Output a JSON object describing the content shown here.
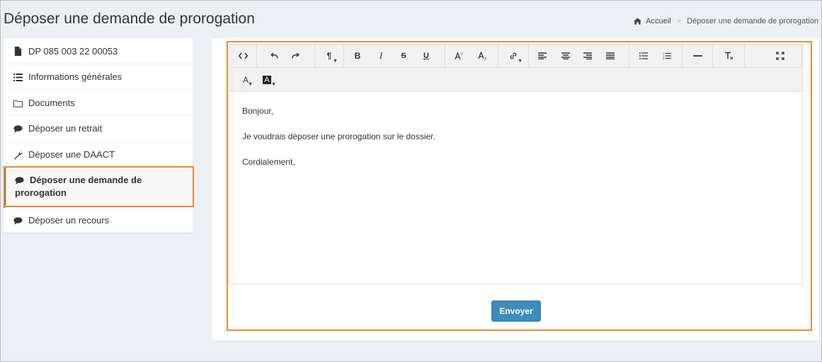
{
  "page": {
    "title": "Déposer une demande de prorogation"
  },
  "breadcrumb": {
    "home": "Accueil",
    "current": "Déposer une demande de prorogation"
  },
  "sidebar": {
    "items": [
      {
        "label": "DP 085 003 22 00053",
        "icon": "file-icon"
      },
      {
        "label": "Informations générales",
        "icon": "list-icon"
      },
      {
        "label": "Documents",
        "icon": "folder-icon"
      },
      {
        "label": "Déposer un retrait",
        "icon": "comment-icon"
      },
      {
        "label": "Déposer une DAACT",
        "icon": "wrench-icon"
      },
      {
        "label": "Déposer une demande de prorogation",
        "icon": "comment-icon",
        "active": true
      },
      {
        "label": "Déposer un recours",
        "icon": "comment-icon"
      }
    ]
  },
  "editor": {
    "toolbar": {
      "bold": "B",
      "italic": "I",
      "strikethrough": "S",
      "underline": "U",
      "paragraph": "¶",
      "font_color": "A",
      "background_color": "A"
    },
    "content": [
      "Bonjour,",
      "Je voudrais déposer une prorogation sur le dossier.",
      "Cordialement,"
    ]
  },
  "actions": {
    "send_label": "Envoyer"
  },
  "colors": {
    "primary": "#3c8dbc",
    "highlight": "#f0892f",
    "background": "#ecf0f5"
  }
}
